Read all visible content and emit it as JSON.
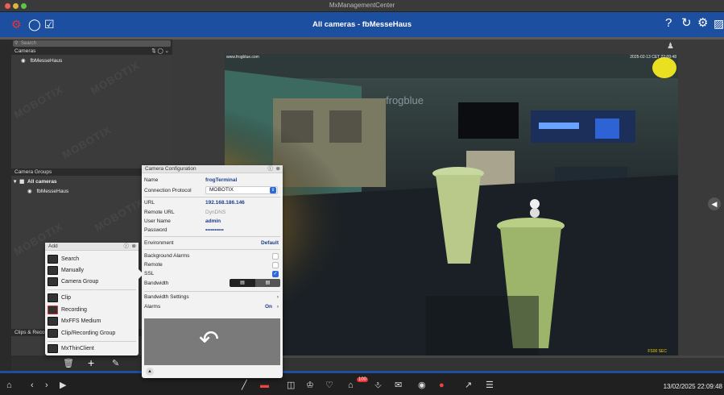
{
  "window": {
    "title": "MxManagementCenter"
  },
  "toolbar": {
    "title": "All cameras - fbMesseHaus",
    "help": "?"
  },
  "sidebar": {
    "search_placeholder": "Search",
    "cameras_header": "Cameras",
    "cameras": [
      "fbMesseHaus"
    ],
    "groups_header": "Camera Groups",
    "groups_root": "All cameras",
    "groups_children": [
      "fbMesseHaus"
    ],
    "clips_header": "Clips & Reco"
  },
  "video": {
    "top_left_text": "www.frogblue.com",
    "top_right_text": "2025-02-13 CET 22:09:48",
    "bottom_right_text": "FS00 SEC",
    "wall_text": "frogblue"
  },
  "camera_config": {
    "title": "Camera Configuration",
    "name_label": "Name",
    "name_value": "frogTerminal",
    "protocol_label": "Connection Protocol",
    "protocol_value": "MOBOTIX",
    "url_label": "URL",
    "url_value": "192.168.186.146",
    "remote_url_label": "Remote URL",
    "remote_url_value": "DynDNS",
    "user_label": "User Name",
    "user_value": "admin",
    "password_label": "Password",
    "password_value": "••••••••••",
    "env_label": "Environment",
    "env_value": "Default",
    "bg_alarms_label": "Background Alarms",
    "remote_label": "Remote",
    "ssl_label": "SSL",
    "bandwidth_label": "Bandwidth",
    "bw_settings_label": "Bandwidth Settings",
    "alarms_label": "Alarms",
    "alarms_value": "On"
  },
  "add_menu": {
    "title": "Add",
    "items": [
      "Search",
      "Manually",
      "Camera Group",
      "Clip",
      "Recording",
      "MxFFS Medium",
      "Clip/Recording Group",
      "MxThinClient"
    ]
  },
  "status": {
    "clock": "13/02/2025 22:09:48",
    "badge": "100"
  }
}
